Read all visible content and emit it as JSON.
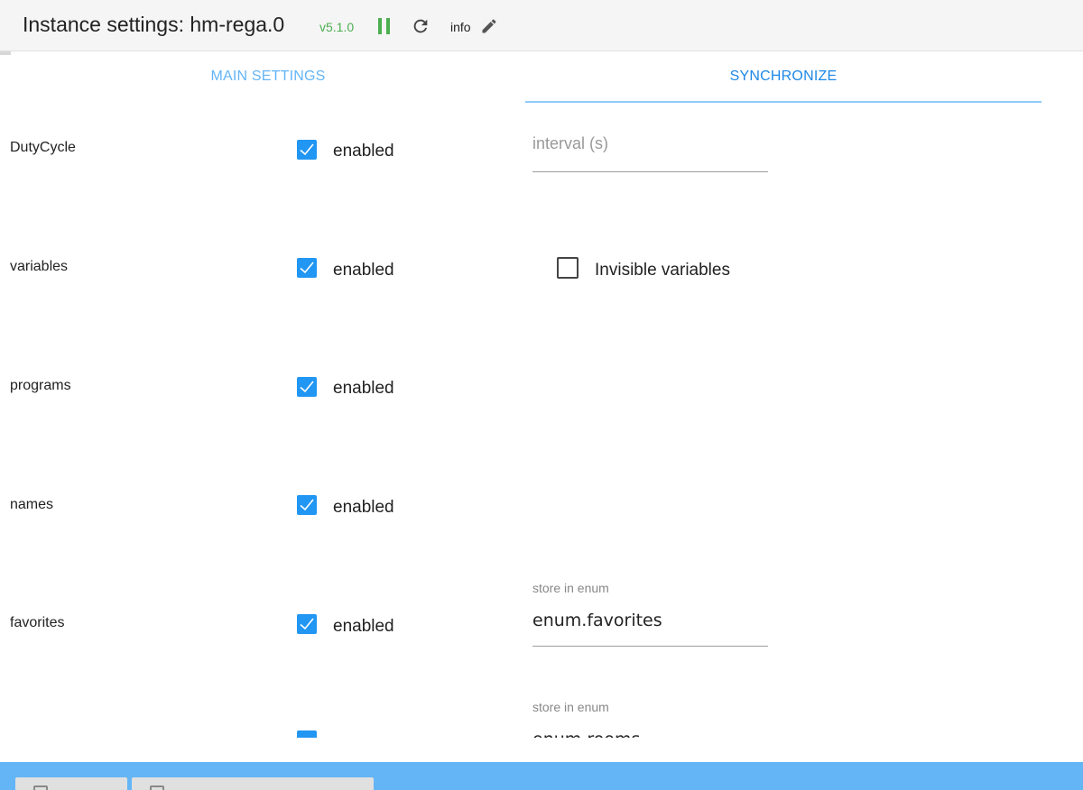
{
  "header": {
    "title": "Instance settings: hm-rega.0",
    "version": "v5.1.0",
    "info_label": "info",
    "icons": [
      "pause-icon",
      "reload-icon",
      "edit-icon"
    ]
  },
  "tabs": [
    {
      "label": "MAIN SETTINGS",
      "active": false
    },
    {
      "label": "SYNCHRONIZE",
      "active": true
    }
  ],
  "rows": [
    {
      "label": "DutyCycle",
      "checkbox_label": "enabled",
      "checked": true
    },
    {
      "label": "variables",
      "checkbox_label": "enabled",
      "checked": true
    },
    {
      "label": "programs",
      "checkbox_label": "enabled",
      "checked": true
    },
    {
      "label": "names",
      "checkbox_label": "enabled",
      "checked": true
    },
    {
      "label": "favorites",
      "checkbox_label": "enabled",
      "checked": true
    }
  ],
  "interval": {
    "placeholder": "interval (s)",
    "value": ""
  },
  "invisible_variables": {
    "label": "Invisible variables",
    "checked": false
  },
  "favorites_enum": {
    "label": "store in enum",
    "value": "enum.favorites"
  },
  "rooms_enum": {
    "label": "store in enum",
    "value": "enum.rooms"
  },
  "colors": {
    "accent": "#2196f3",
    "tab_active": "#1e88e5",
    "tab_inactive": "#64b5f6",
    "version": "#4caf50",
    "footer": "#64b5f6"
  }
}
